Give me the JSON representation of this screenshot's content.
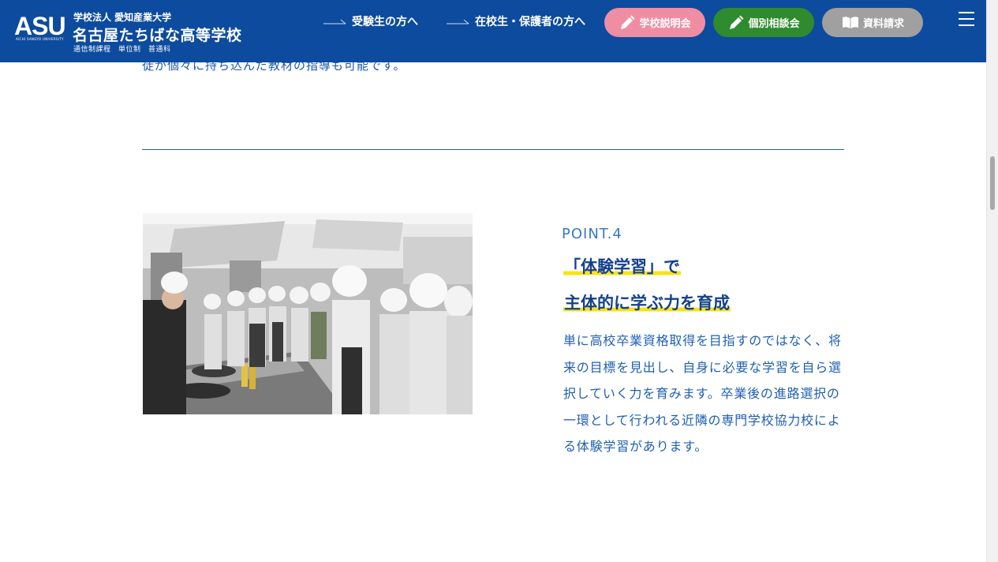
{
  "header": {
    "logo_text": "ASU",
    "logo_subtext": "AICHI SANGYO UNIVERSITY",
    "school_org": "学校法人 愛知産業大学",
    "school_name": "名古屋たちばな高等学校",
    "school_courses": "通信制課程　単位制　普通科",
    "nav": [
      {
        "label": "受験生の方へ"
      },
      {
        "label": "在校生・保護者の方へ"
      }
    ],
    "buttons": [
      {
        "label": "学校説明会",
        "color": "#ef8ea3"
      },
      {
        "label": "個別相談会",
        "color": "#2e8b2e"
      },
      {
        "label": "資料請求",
        "color": "#a0a0a0"
      }
    ],
    "colors": {
      "header_bg": "#0d4b9e",
      "accent_yellow": "#f6e418"
    }
  },
  "content": {
    "top_text": "徒が個々に持ち込んだ教材の指導も可能です。",
    "point": {
      "label": "POINT.4",
      "heading_line1": "「体験学習」で",
      "heading_line2": "主体的に学ぶ力を育成",
      "body": "単に高校卒業資格取得を目指すのではなく、将来の目標を見出し、自身に必要な学習を自ら選択していく力を育みます。卒業後の進路選択の一環として行われる近隣の専門学校協力校による体験学習があります。"
    }
  }
}
